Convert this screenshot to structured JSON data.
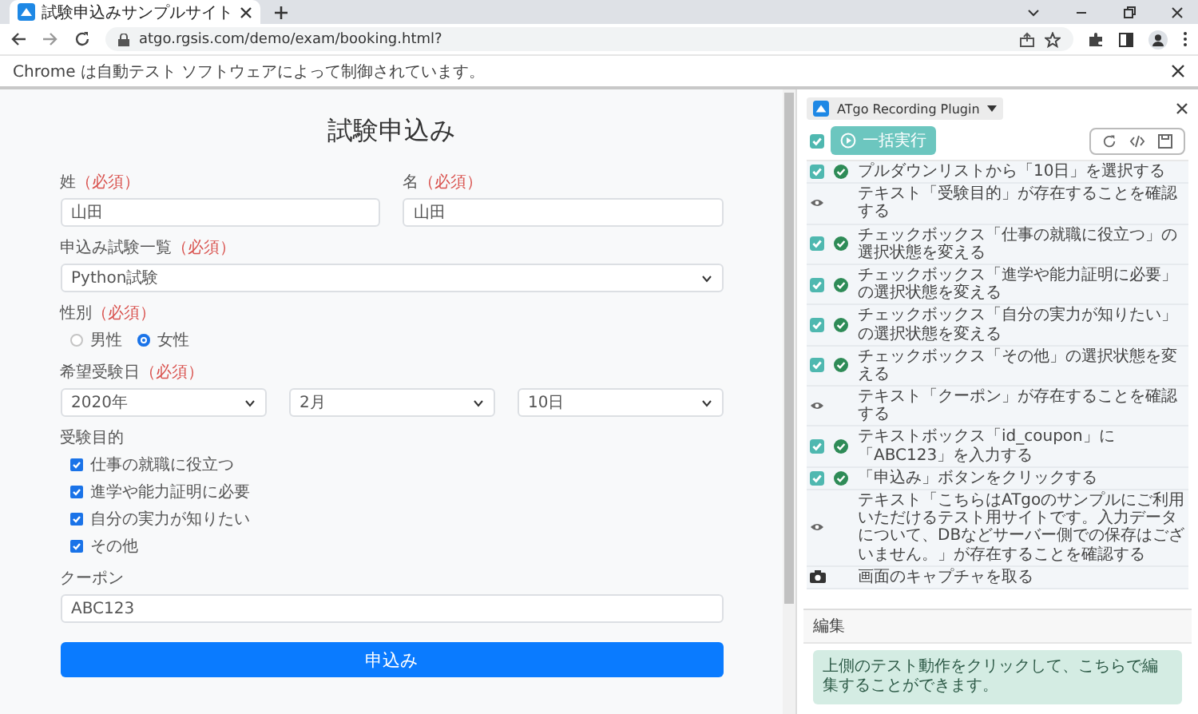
{
  "browser": {
    "tab_title": "試験申込みサンプルサイト",
    "url": "atgo.rgsis.com/demo/exam/booking.html?",
    "infobar": "Chrome は自動テスト ソフトウェアによって制御されています。"
  },
  "form": {
    "title": "試験申込み",
    "name_fields": [
      {
        "label": "姓",
        "required": "（必須）",
        "value": "山田"
      },
      {
        "label": "名",
        "required": "（必須）",
        "value": "山田"
      }
    ],
    "exam": {
      "label": "申込み試験一覧",
      "required": "（必須）",
      "value": "Python試験"
    },
    "gender": {
      "label": "性別",
      "required": "（必須）",
      "options": [
        {
          "label": "男性",
          "selected": false
        },
        {
          "label": "女性",
          "selected": true
        }
      ]
    },
    "date": {
      "label": "希望受験日",
      "required": "（必須）",
      "selects": [
        "2020年",
        "2月",
        "10日"
      ]
    },
    "purpose": {
      "label": "受験目的",
      "options": [
        {
          "label": "仕事の就職に役立つ",
          "checked": true
        },
        {
          "label": "進学や能力証明に必要",
          "checked": true
        },
        {
          "label": "自分の実力が知りたい",
          "checked": true
        },
        {
          "label": "その他",
          "checked": true
        }
      ]
    },
    "coupon": {
      "label": "クーポン",
      "value": "ABC123"
    },
    "submit": "申込み"
  },
  "plugin": {
    "title": "ATgo Recording Plugin",
    "run_all": {
      "label": "一括実行",
      "checked": true
    },
    "steps": [
      {
        "kind": "action",
        "checked": true,
        "text": "プルダウンリストから「10日」を選択する"
      },
      {
        "kind": "assert",
        "text": "テキスト「受験目的」が存在することを確認する"
      },
      {
        "kind": "action",
        "checked": true,
        "text": "チェックボックス「仕事の就職に役立つ」の選択状態を変える"
      },
      {
        "kind": "action",
        "checked": true,
        "text": "チェックボックス「進学や能力証明に必要」の選択状態を変える"
      },
      {
        "kind": "action",
        "checked": true,
        "text": "チェックボックス「自分の実力が知りたい」の選択状態を変える"
      },
      {
        "kind": "action",
        "checked": true,
        "text": "チェックボックス「その他」の選択状態を変える"
      },
      {
        "kind": "assert",
        "text": "テキスト「クーポン」が存在することを確認する"
      },
      {
        "kind": "action",
        "checked": true,
        "text": "テキストボックス「id_coupon」に「ABC123」を入力する"
      },
      {
        "kind": "action",
        "checked": true,
        "text": "「申込み」ボタンをクリックする"
      },
      {
        "kind": "assert",
        "text": "テキスト「こちらはATgoのサンプルにご利用いただけるテスト用サイトです。入力データについて、DBなどサーバー側での保存はございません。」が存在することを確認する"
      },
      {
        "kind": "capture",
        "text": "画面のキャプチャを取る"
      }
    ],
    "edit": {
      "title": "編集",
      "message": "上側のテスト動作をクリックして、こちらで編集することができます。"
    }
  }
}
